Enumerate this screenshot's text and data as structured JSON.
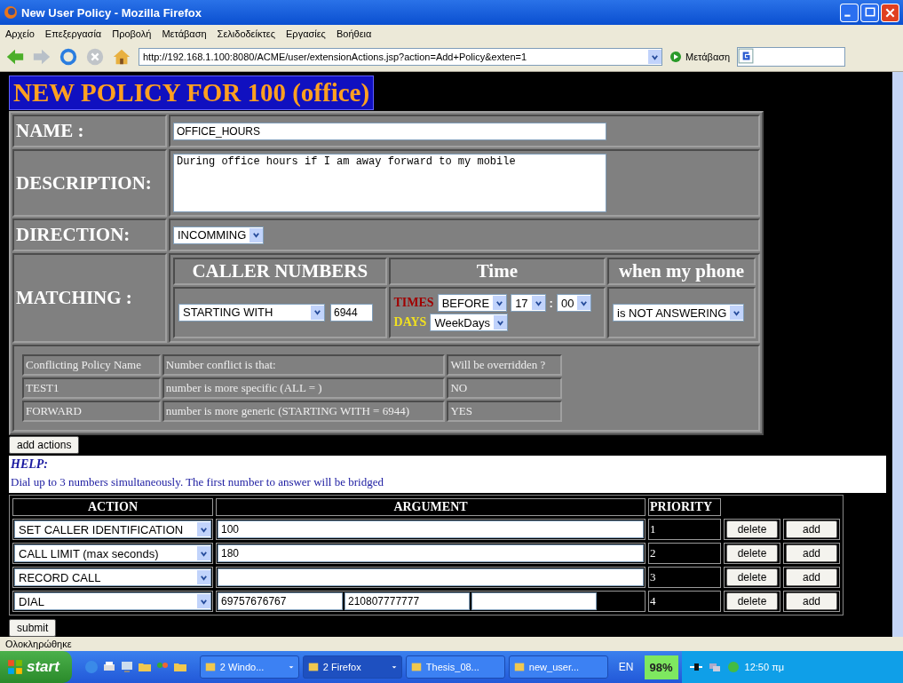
{
  "window": {
    "title": "New User Policy - Mozilla Firefox"
  },
  "menu": [
    "Αρχείο",
    "Επεξεργασία",
    "Προβολή",
    "Μετάβαση",
    "Σελιδοδείκτες",
    "Εργασίες",
    "Βοήθεια"
  ],
  "toolbar": {
    "url": "http://192.168.1.100:8080/ACME/user/extensionActions.jsp?action=Add+Policy&exten=1",
    "go": "Μετάβαση"
  },
  "page": {
    "heading": "NEW POLICY FOR 100 (office)",
    "name": {
      "label": "NAME :",
      "value": "OFFICE_HOURS"
    },
    "description": {
      "label": "DESCRIPTION:",
      "value": "During office hours if I am away forward to my mobile"
    },
    "direction": {
      "label": "DIRECTION:",
      "value": "INCOMMING"
    },
    "matching": {
      "label": "MATCHING :",
      "columns": [
        "CALLER NUMBERS",
        "Time",
        "when my phone"
      ],
      "caller_mode": "STARTING WITH",
      "caller_number": "6944",
      "times_label": "TIMES",
      "times_mode": "BEFORE",
      "hour": "17",
      "separator": ":",
      "minute": "00",
      "days_label": "DAYS",
      "days": "WeekDays",
      "phone_state": "is NOT ANSWERING"
    },
    "conflicts": {
      "columns": [
        "Conflicting Policy Name",
        "Number conflict is that:",
        "Will be overridden ?"
      ],
      "rows": [
        [
          "TEST1",
          "number is more specific (ALL = )",
          "NO"
        ],
        [
          "FORWARD",
          "number is more generic (STARTING WITH = 6944)",
          "YES"
        ]
      ]
    },
    "add_actions": "add actions",
    "help": {
      "title": "HELP:",
      "text": "Dial up to 3 numbers simultaneously. The first number to answer will be bridged"
    },
    "actions": {
      "columns": [
        "ACTION",
        "ARGUMENT",
        "PRIORITY"
      ],
      "rows": [
        {
          "kind": "single",
          "action": "SET CALLER IDENTIFICATION",
          "arguments": [
            "100"
          ],
          "priority": "1",
          "delete": "delete",
          "add": "add"
        },
        {
          "kind": "single",
          "action": "CALL LIMIT (max seconds)",
          "arguments": [
            "180"
          ],
          "priority": "2",
          "delete": "delete",
          "add": "add"
        },
        {
          "kind": "single",
          "action": "RECORD CALL",
          "priority": "3",
          "delete": "delete",
          "add": "add"
        },
        {
          "kind": "multi",
          "action": "DIAL",
          "arguments": [
            "69757676767",
            "210807777777"
          ],
          "priority": "4",
          "delete": "delete",
          "add": "add"
        }
      ]
    },
    "submit": "submit"
  },
  "status_bar": "Ολοκληρώθηκε",
  "taskbar": {
    "start": "start",
    "tasks": [
      {
        "label": "2 Windo...",
        "selected": false,
        "kind": "group"
      },
      {
        "label": "2 Firefox",
        "selected": true,
        "kind": "group"
      },
      {
        "label": "Thesis_08...",
        "selected": false,
        "kind": "single"
      },
      {
        "label": "new_user...",
        "selected": false,
        "kind": "single"
      }
    ],
    "language": "EN",
    "battery": "98%",
    "clock": "12:50 πμ"
  }
}
